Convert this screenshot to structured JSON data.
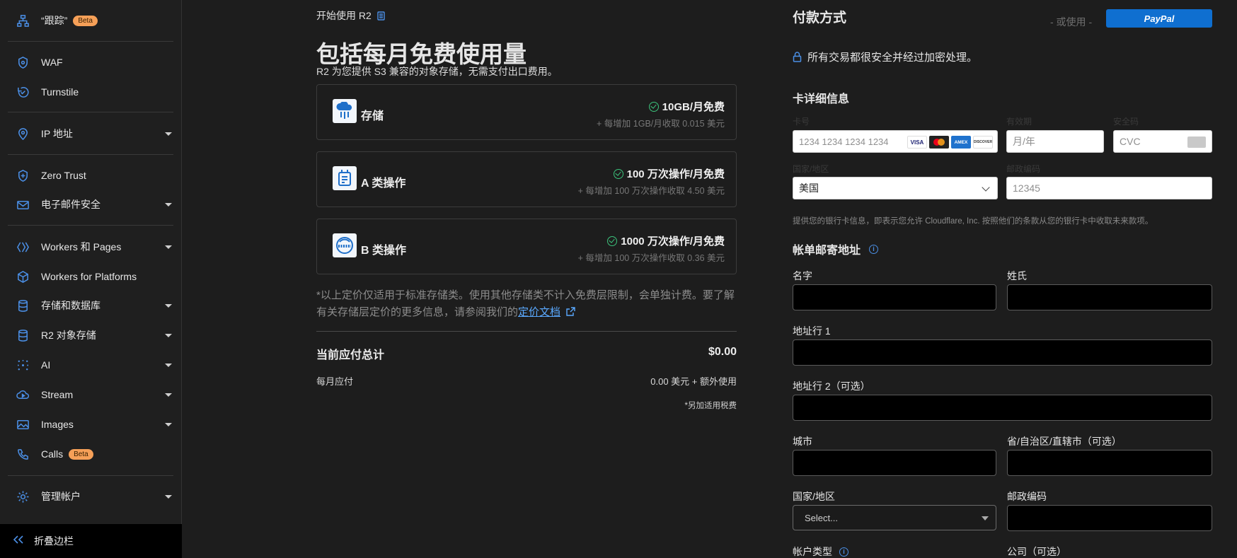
{
  "sidebar": {
    "items": [
      {
        "label": "“跟踪”",
        "icon": "sitemap-icon",
        "badge": "Beta"
      },
      {
        "label": "WAF",
        "icon": "shield-icon"
      },
      {
        "label": "Turnstile",
        "icon": "turnstile-icon"
      },
      {
        "label": "IP 地址",
        "icon": "location-pin-icon"
      },
      {
        "label": "Zero Trust",
        "icon": "zero-trust-icon"
      },
      {
        "label": "电子邮件安全",
        "icon": "mail-icon"
      },
      {
        "label": "Workers 和 Pages",
        "icon": "workers-icon"
      },
      {
        "label": "Workers for Platforms",
        "icon": "cube-icon"
      },
      {
        "label": "存储和数据库",
        "icon": "database-icon"
      },
      {
        "label": "R2 对象存储",
        "icon": "database-icon"
      },
      {
        "label": "AI",
        "icon": "sparkle-icon"
      },
      {
        "label": "Stream",
        "icon": "cloud-play-icon"
      },
      {
        "label": "Images",
        "icon": "image-icon"
      },
      {
        "label": "Calls",
        "icon": "phone-icon",
        "badge": "Beta"
      },
      {
        "label": "管理帐户",
        "icon": "gear-icon"
      }
    ],
    "collapse_label": "折叠边栏"
  },
  "main": {
    "breadcrumb": "开始使用 R2",
    "title": "包括每月免费使用量",
    "subtitle": "R2 为您提供 S3 兼容的对象存储，无需支付出口费用。",
    "plans": [
      {
        "name": "存储",
        "free": "10GB/月免费",
        "extra": "+ 每增加 1GB/月收取 0.015 美元"
      },
      {
        "name": "A 类操作",
        "free": "100 万次操作/月免费",
        "extra": "+ 每增加 100 万次操作收取 4.50 美元"
      },
      {
        "name": "B 类操作",
        "free": "1000 万次操作/月免费",
        "extra": "+ 每增加 100 万次操作收取 0.36 美元"
      }
    ],
    "note": "*以上定价仅适用于标准存储类。使用其他存储类不计入免费层限制，会单独计费。要了解有关存储层定价的更多信息，请参阅我们的",
    "note_link": "定价文档",
    "total_label": "当前应付总计",
    "total_value": "$0.00",
    "monthly_label": "每月应付",
    "monthly_value": "0.00 美元 + 额外使用",
    "tax_note": "*另加适用税费"
  },
  "payment": {
    "title": "付款方式",
    "or_use": "- 或使用 -",
    "paypal_label": "PayPal",
    "secure_text": "所有交易都很安全并经过加密处理。",
    "card_section": "卡详细信息",
    "card_number_label": "卡号",
    "card_number_placeholder": "1234 1234 1234 1234",
    "expiry_label": "有效期",
    "expiry_placeholder": "月/年",
    "cvc_label": "安全码",
    "cvc_placeholder": "CVC",
    "country_label": "国家/地区",
    "country_value": "美国",
    "postal_label": "邮政编码",
    "postal_placeholder": "12345",
    "legal_text": "提供您的银行卡信息，即表示您允许 Cloudflare, Inc. 按照他们的条款从您的银行卡中收取未来款项。",
    "card_brands": [
      "VISA",
      "MC",
      "AMEX",
      "DISCOVER"
    ],
    "billing_section": "帐单邮寄地址",
    "fields": {
      "first_name": "名字",
      "last_name": "姓氏",
      "address1": "地址行 1",
      "address2": "地址行 2（可选）",
      "city": "城市",
      "state": "省/自治区/直辖市（可选）",
      "country": "国家/地区",
      "postal": "邮政编码",
      "account_type": "帐户类型",
      "company": "公司（可选）"
    },
    "country_select_value": "Select..."
  },
  "colors": {
    "accent": "#3b82f6",
    "paypal": "#0f6fd0",
    "check": "#3cc47c",
    "badge": "#f6a058",
    "link": "#5aa9ff"
  }
}
